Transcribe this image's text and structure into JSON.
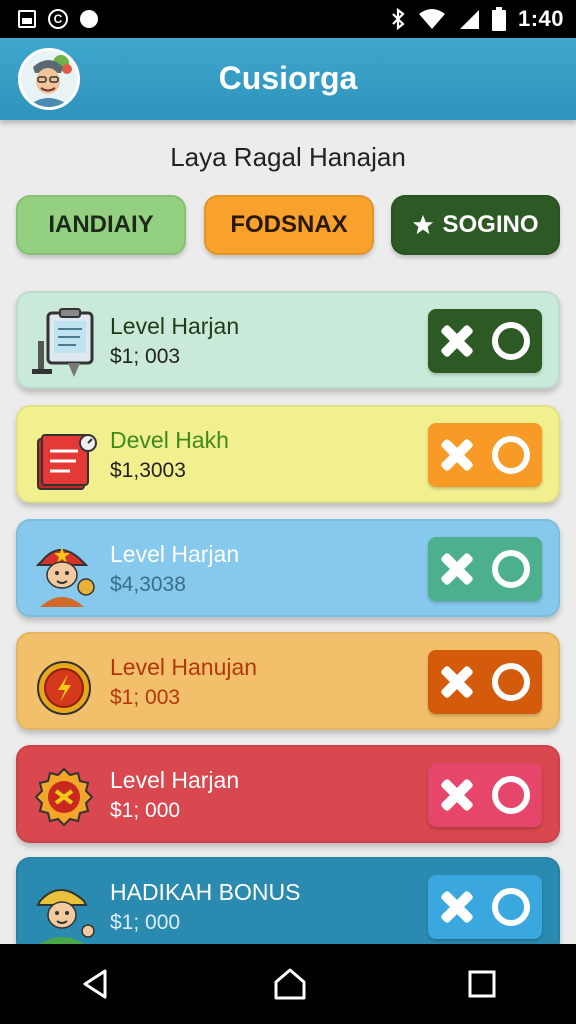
{
  "status_bar": {
    "time": "1:40",
    "left_icons": [
      "image-icon",
      "copyright-circle-icon",
      "dot-icon"
    ],
    "right_icons": [
      "bluetooth-icon",
      "wifi-icon",
      "signal-icon",
      "battery-icon"
    ]
  },
  "app_bar": {
    "title": "Cusiorga",
    "color": "#3399c4"
  },
  "subtitle": "Laya Ragal Hanajan",
  "filters": [
    {
      "label": "IANDIAIY",
      "color": "#93d07f"
    },
    {
      "label": "FODSNAX",
      "color": "#f8a12c"
    },
    {
      "label": "SOGINO",
      "icon": "star-icon",
      "color": "#2d5a24"
    }
  ],
  "levels": [
    {
      "title": "Level Harjan",
      "price": "$1; 003",
      "icon": "clipboard-icon",
      "bg": "#c9ead8",
      "btn": "#2d5a24",
      "title_color": "#1f3d1a",
      "price_color": "#222"
    },
    {
      "title": "Devel Hakh",
      "price": "$1,3003",
      "icon": "book-icon",
      "bg": "#f2f08e",
      "btn": "#f79a26",
      "title_color": "#3e8a1f",
      "price_color": "#222"
    },
    {
      "title": "Level Harjan",
      "price": "$4,3038",
      "icon": "firefighter-icon",
      "bg": "#86c9ec",
      "btn": "#4cb08e",
      "title_color": "#ffffff",
      "price_color": "#3a6e8c"
    },
    {
      "title": "Level Hanujan",
      "price": "$1; 003",
      "icon": "coin-icon",
      "bg": "#f2c06a",
      "btn": "#d45a0c",
      "title_color": "#b2380c",
      "price_color": "#b2380c"
    },
    {
      "title": "Level Harjan",
      "price": "$1; 000",
      "icon": "badge-icon",
      "bg": "#d9474f",
      "btn": "#e5466a",
      "title_color": "#ffffff",
      "price_color": "#ffffff"
    },
    {
      "title": "HADIKAH BONUS",
      "price": "$1; 000",
      "icon": "worker-icon",
      "bg": "#2a8ab0",
      "btn": "#3aa7df",
      "title_color": "#ffffff",
      "price_color": "#dbeef7"
    }
  ],
  "nav_bar": {
    "buttons": [
      "back-icon",
      "home-icon",
      "recents-icon"
    ]
  }
}
